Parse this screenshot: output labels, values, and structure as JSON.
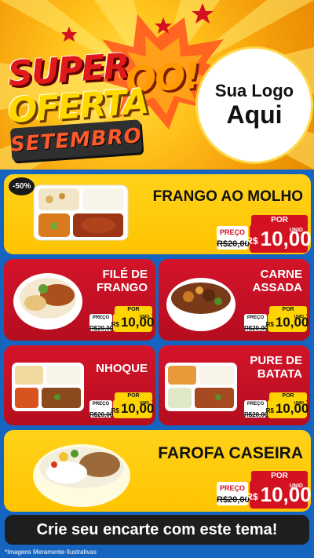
{
  "header": {
    "word_super": "SUPER",
    "word_oo": "OO!",
    "word_oferta": "OFERTA",
    "month": "SETEMBRO",
    "logo_line1": "Sua Logo",
    "logo_line2": "Aqui"
  },
  "colors": {
    "header_yellow": "#ffc21a",
    "card_yellow": "#ffc400",
    "card_red": "#c4112a",
    "price_red": "#d31120",
    "price_yellow": "#ffd400",
    "background_blue": "#1565c0"
  },
  "products": [
    {
      "title": "FRANGO AO MOLHO",
      "badge": "-50%",
      "por": "POR",
      "preco_label": "PREÇO",
      "old_price": "R$20,00",
      "currency": "R$",
      "price": "10,00",
      "unit": "UNID"
    },
    {
      "title_line1": "FILÉ DE",
      "title_line2": "FRANGO",
      "por": "POR",
      "preco_label": "PREÇO",
      "old_price": "R$20,00",
      "currency": "R$",
      "price": "10,00",
      "unit": "UNID"
    },
    {
      "title_line1": "CARNE",
      "title_line2": "ASSADA",
      "por": "POR",
      "preco_label": "PREÇO",
      "old_price": "R$20,00",
      "currency": "R$",
      "price": "10,00",
      "unit": "UNID"
    },
    {
      "title": "NHOQUE",
      "por": "POR",
      "preco_label": "PREÇO",
      "old_price": "R$20,00",
      "currency": "R$",
      "price": "10,00",
      "unit": "UNID"
    },
    {
      "title_line1": "PURE DE",
      "title_line2": "BATATA",
      "por": "POR",
      "preco_label": "PREÇO",
      "old_price": "R$20,00",
      "currency": "R$",
      "price": "10,00",
      "unit": "UNID"
    },
    {
      "title": "FAROFA CASEIRA",
      "por": "POR",
      "preco_label": "PREÇO",
      "old_price": "R$20,00",
      "currency": "R$",
      "price": "10,00",
      "unit": "UNID"
    }
  ],
  "cta": "Crie seu encarte com este tema!",
  "footnote": "*Imagens Meramente Ilustrativas"
}
